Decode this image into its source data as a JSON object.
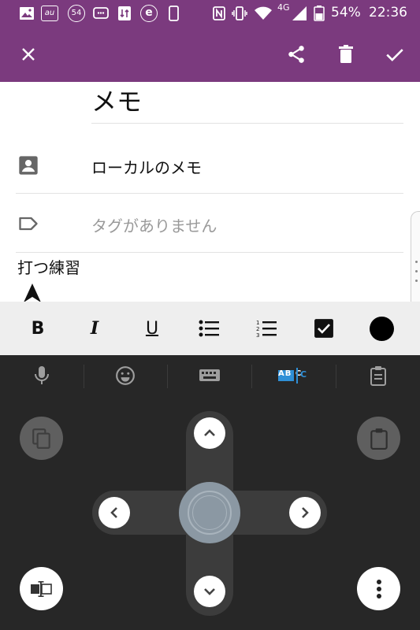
{
  "status_bar": {
    "carrier_badge": "au",
    "badge_number": "54",
    "network_type": "4G",
    "battery_percent": "54%",
    "time": "22:36"
  },
  "app_bar": {
    "color": "#7b3a7e",
    "icons": [
      "close-icon",
      "share-icon",
      "delete-icon",
      "check-icon"
    ]
  },
  "note": {
    "title": "メモ",
    "account_label": "ローカルのメモ",
    "tags_placeholder": "タグがありません",
    "body_text": "打つ練習"
  },
  "format_bar": {
    "bold_label": "B",
    "italic_label": "I",
    "underline_label": "U",
    "tools": [
      "bold",
      "italic",
      "underline",
      "bulleted-list",
      "numbered-list",
      "checkbox",
      "text-color"
    ],
    "text_color": "#000000"
  },
  "keyboard": {
    "tabs": [
      "mic-icon",
      "emoji-icon",
      "keyboard-icon",
      "text-editing-icon",
      "clipboard-icon"
    ],
    "active_tab": "text-editing-icon",
    "accent": "#2f8fd6",
    "text_editing_label": "AB C"
  }
}
